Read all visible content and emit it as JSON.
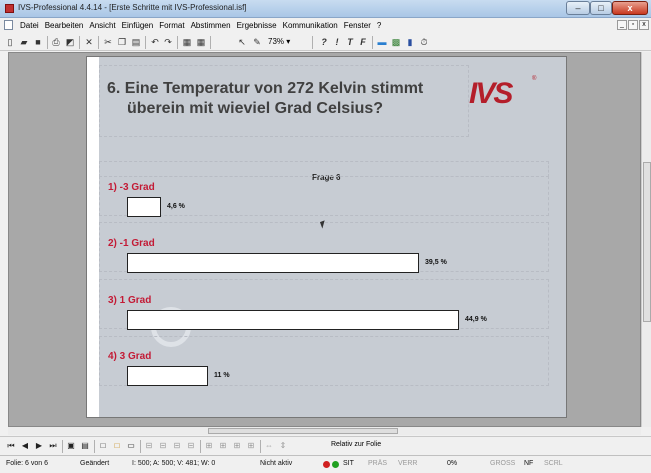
{
  "window": {
    "title": "IVS-Professional 4.4.14 - [Erste Schritte mit IVS-Professional.isf]",
    "min_label": "–",
    "max_label": "□",
    "close_label": "x"
  },
  "menu": {
    "items": [
      "Datei",
      "Bearbeiten",
      "Ansicht",
      "Einfügen",
      "Format",
      "Abstimmen",
      "Ergebnisse",
      "Kommunikation",
      "Fenster",
      "?"
    ],
    "mdi": [
      "_",
      "▫",
      "x"
    ]
  },
  "toolbar": {
    "zoom": "73%",
    "buttons": [
      "new-icon",
      "open-icon",
      "save-icon",
      "print-icon",
      "properties-icon",
      "delete-icon",
      "cut-icon",
      "copy-icon",
      "paste-icon",
      "undo-icon",
      "redo-icon",
      "pointer-icon",
      "pen-icon"
    ],
    "format_labels": [
      "?",
      "!",
      "T",
      "F"
    ]
  },
  "slide": {
    "question": "6. Eine Temperatur von 272 Kelvin stimmt übereinein mit wieviel Grad Celsius?",
    "question_line1": "6. Eine Temperatur von 272 Kelvin stimmt",
    "question_line2": "überein mit wieviel Grad Celsius?",
    "logo": "IVS",
    "logo_mark": "®",
    "frage": "Frage 6",
    "accent_color": "#c31a35",
    "answers": [
      {
        "label": "1) -3 Grad",
        "percent": "4,6 %",
        "value": 4.6
      },
      {
        "label": "2) -1 Grad",
        "percent": "39,5 %",
        "value": 39.5
      },
      {
        "label": "3) 1 Grad",
        "percent": "44,9 %",
        "value": 44.9
      },
      {
        "label": "4) 3 Grad",
        "percent": "11 %",
        "value": 11
      }
    ]
  },
  "navbar": {
    "relativ": "Relativ zur Folie"
  },
  "status": {
    "folie": "Folie: 6 von 6",
    "state": "Geändert",
    "coords": "I: 500;  A: 500;  V: 481;  W: 0",
    "activity": "Nicht aktiv",
    "sit": "SIT",
    "pras": "PRÄS",
    "verr": "VERR",
    "percent": "0%",
    "gross": "GROSS",
    "nf": "NF",
    "scrl": "SCRL"
  }
}
